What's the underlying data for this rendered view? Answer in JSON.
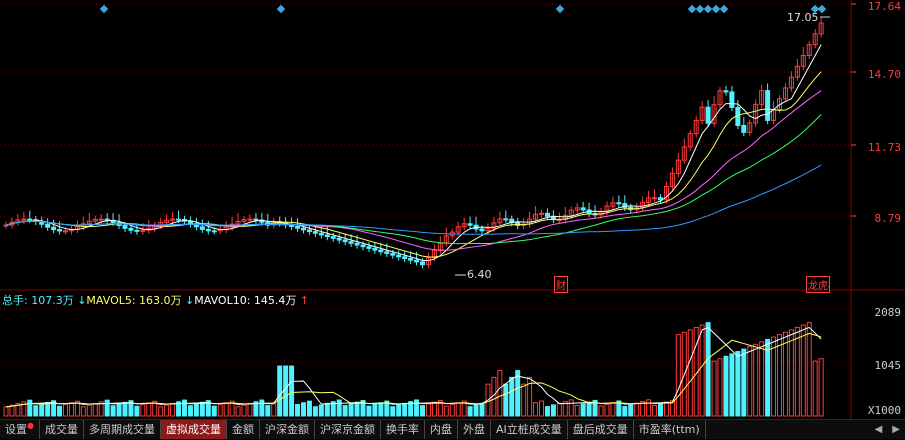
{
  "price_axis": {
    "labels": [
      "17.64",
      "14.70",
      "11.73",
      "8.79"
    ],
    "color": "#ff3b3b"
  },
  "volume_axis": {
    "labels": [
      "2089",
      "1045"
    ],
    "unit": "X1000"
  },
  "annotations": {
    "high_price": "17.05",
    "low_price": "6.40",
    "event_a": "财",
    "event_b": "龙虎榜"
  },
  "volume_info": {
    "total_label": "总手: 107.3万",
    "mavol5_label": "MAVOL5: 163.0万",
    "mavol10_label": "MAVOL10: 145.4万"
  },
  "tabs": [
    {
      "label": "设置",
      "active": false,
      "dot": true
    },
    {
      "label": "成交量",
      "active": false
    },
    {
      "label": "多周期成交量",
      "active": false
    },
    {
      "label": "虚拟成交量",
      "active": true
    },
    {
      "label": "金额",
      "active": false
    },
    {
      "label": "沪深金额",
      "active": false
    },
    {
      "label": "沪深京金额",
      "active": false
    },
    {
      "label": "换手率",
      "active": false
    },
    {
      "label": "内盘",
      "active": false
    },
    {
      "label": "外盘",
      "active": false
    },
    {
      "label": "AI立桩成交量",
      "active": false
    },
    {
      "label": "盘后成交量",
      "active": false
    },
    {
      "label": "市盈率(ttm)",
      "active": false
    }
  ],
  "nav": {
    "prev": "◀",
    "next": "▶"
  },
  "colors": {
    "up": "#ff3b3b",
    "down": "#4df2ff",
    "ma5": "#ffffff",
    "ma10": "#ffff66",
    "ma20": "#ff66ff",
    "ma30": "#33ff66",
    "ma60": "#3399ff",
    "grid": "#800000"
  }
}
